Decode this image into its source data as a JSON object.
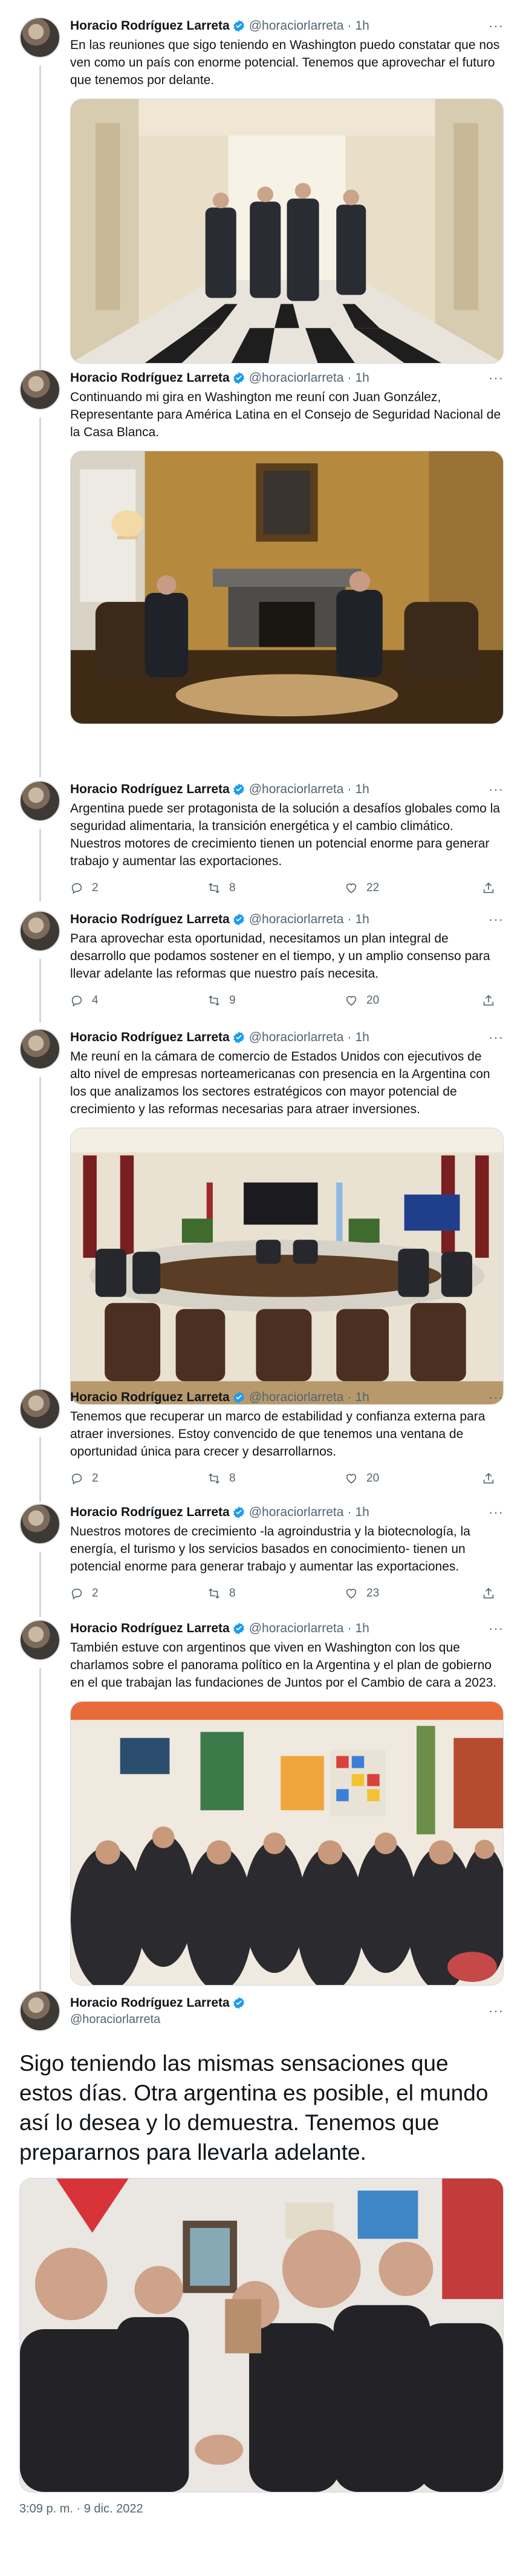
{
  "author": {
    "name": "Horacio Rodríguez Larreta",
    "handle": "@horaciorlarreta",
    "time": "1h",
    "more": "···"
  },
  "tweets": [
    {
      "text": "En las reuniones que sigo teniendo en Washington puedo constatar que nos ven como un país con enorme potencial. Tenemos que aprovechar el futuro que tenemos por delante."
    },
    {
      "text": "Continuando mi gira en Washington me reuní con Juan González, Representante para América Latina en el Consejo de Seguridad Nacional de la Casa Blanca."
    },
    {
      "text": "Argentina puede ser protagonista de la solución a desafíos globales como la seguridad alimentaria, la transición energética y el cambio climático. Nuestros motores de crecimiento tienen un potencial enorme para generar trabajo y aumentar las exportaciones.",
      "replies": "2",
      "retweets": "8",
      "likes": "22"
    },
    {
      "text": "Para aprovechar esta oportunidad, necesitamos un plan integral de desarrollo que podamos sostener en el tiempo, y un amplio consenso para llevar adelante las reformas que nuestro país necesita.",
      "replies": "4",
      "retweets": "9",
      "likes": "20"
    },
    {
      "text": "Me reuní en la cámara de comercio de Estados Unidos con ejecutivos de alto nivel de empresas norteamericanas con presencia en la Argentina con los que analizamos los sectores estratégicos con mayor potencial de crecimiento y las reformas necesarias para atraer inversiones."
    },
    {
      "text": "Tenemos que recuperar un marco de estabilidad y confianza externa para atraer inversiones. Estoy convencido de que tenemos una ventana de oportunidad única para crecer y desarrollarnos.",
      "replies": "2",
      "retweets": "8",
      "likes": "20"
    },
    {
      "text": "Nuestros motores de crecimiento -la agroindustria y la biotecnología, la energía, el turismo y los servicios basados en conocimiento- tienen un potencial enorme para generar trabajo y aumentar las exportaciones.",
      "replies": "2",
      "retweets": "8",
      "likes": "23"
    },
    {
      "text": "También estuve con argentinos que viven en Washington con los que charlamos sobre el panorama político en la Argentina y el plan de gobierno en el que trabajan las fundaciones de Juntos por el Cambio de cara a 2023."
    }
  ],
  "main_tweet": {
    "text": "Sigo teniendo las mismas sensaciones que estos días. Otra argentina es posible, el mundo así lo desea y lo demuestra. Tenemos que prepararnos para llevarla adelante.",
    "timestamp": "3:09 p. m. · 9 dic. 2022"
  },
  "colors": {
    "verified": "#1d9bf0",
    "muted": "#536471",
    "text": "#0f1419",
    "line": "#cfd9de"
  },
  "icons": [
    "verified-icon",
    "reply-icon",
    "retweet-icon",
    "like-icon",
    "share-icon",
    "more-icon"
  ]
}
